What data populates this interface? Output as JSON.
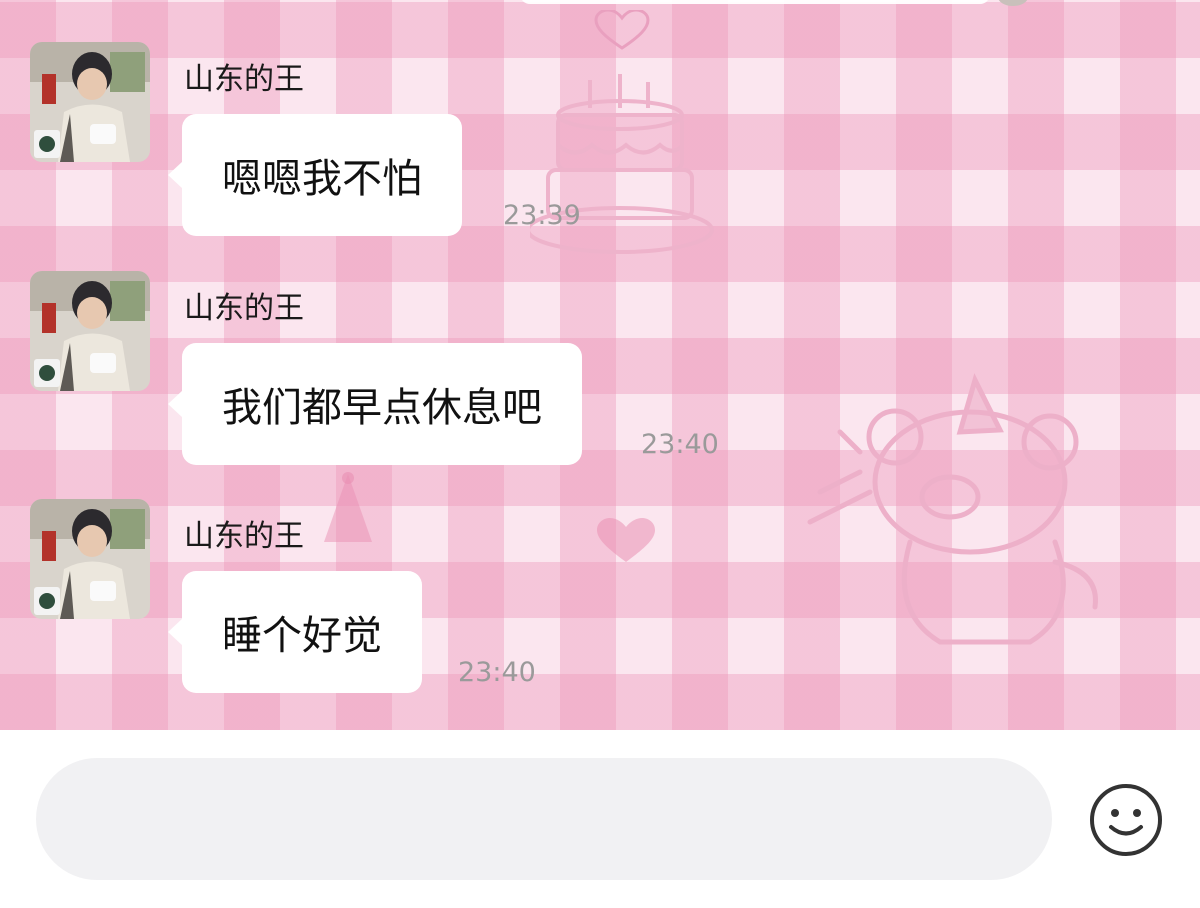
{
  "chat": {
    "messages": [
      {
        "sender": "山东的王",
        "text": "嗯嗯我不怕",
        "time": "23:39"
      },
      {
        "sender": "山东的王",
        "text": "我们都早点休息吧",
        "time": "23:40"
      },
      {
        "sender": "山东的王",
        "text": "睡个好觉",
        "time": "23:40"
      }
    ]
  },
  "input": {
    "placeholder": ""
  },
  "icons": {
    "emoji": "smiley-face-icon",
    "decor": [
      "heart-icon",
      "birthday-cake-icon",
      "party-bear-icon"
    ]
  },
  "colors": {
    "background": "#fbe6ef",
    "check": "#ec96b9",
    "bubble": "#ffffff",
    "timestamp": "#9a9a9a"
  }
}
